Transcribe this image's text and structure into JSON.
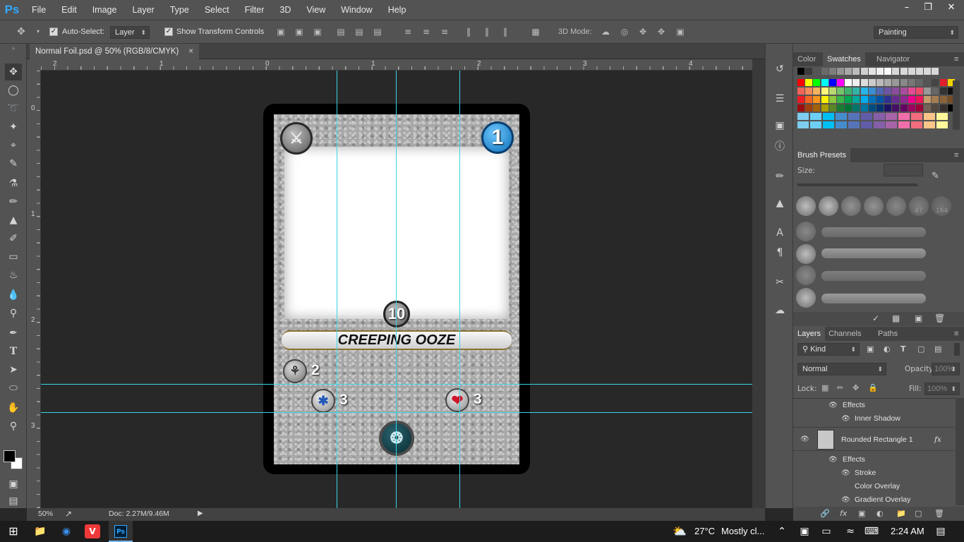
{
  "app": {
    "logo": "Ps"
  },
  "menu": [
    "File",
    "Edit",
    "Image",
    "Layer",
    "Type",
    "Select",
    "Filter",
    "3D",
    "View",
    "Window",
    "Help"
  ],
  "window_controls": {
    "minimize": "–",
    "restore": "❐",
    "close": "✕"
  },
  "options": {
    "auto_select_label": "Auto-Select:",
    "auto_select_checked": true,
    "auto_select_target": "Layer",
    "show_transform_label": "Show Transform Controls",
    "show_transform_checked": true,
    "mode3d_label": "3D Mode:",
    "workspace": "Painting"
  },
  "document": {
    "tab_title": "Normal Foil.psd @ 50% (RGB/8/CMYK)",
    "close": "×",
    "ruler_top": [
      "2",
      "1",
      "0",
      "1",
      "2",
      "3",
      "4"
    ],
    "ruler_left": [
      "0",
      "1",
      "2",
      "3"
    ]
  },
  "status": {
    "zoom": "50%",
    "doc": "Doc: 2.27M/9.46M"
  },
  "card": {
    "name": "CREEPING OOZE",
    "cost": "1",
    "level": "10",
    "attack": "2",
    "speed": "3",
    "health": "3"
  },
  "panels": {
    "color_tabs": [
      "Color",
      "Swatches",
      "Navigator"
    ],
    "brush_title": "Brush Presets",
    "brush_size_label": "Size:",
    "brush_sizes": [
      "47",
      "164"
    ],
    "layers_tabs": [
      "Layers",
      "Channels",
      "Paths"
    ],
    "kind_label": "Kind",
    "blend_mode": "Normal",
    "opacity_label": "Opacity:",
    "opacity_value": "100%",
    "lock_label": "Lock:",
    "fill_label": "Fill:",
    "fill_value": "100%",
    "layers": [
      {
        "label": "Effects",
        "indent": 1
      },
      {
        "label": "Inner Shadow",
        "indent": 2
      },
      {
        "label": "Rounded Rectangle 1",
        "indent": 0
      },
      {
        "label": "Effects",
        "indent": 1
      },
      {
        "label": "Stroke",
        "indent": 2
      },
      {
        "label": "Color Overlay",
        "indent": 2
      },
      {
        "label": "Gradient Overlay",
        "indent": 2
      }
    ],
    "fx_label": "fx"
  },
  "taskbar": {
    "temperature": "27°C",
    "weather": "Mostly cl...",
    "time": "2:24 AM"
  },
  "colors": {
    "guide": "#39d6e6",
    "ps_blue": "#31a8ff"
  }
}
